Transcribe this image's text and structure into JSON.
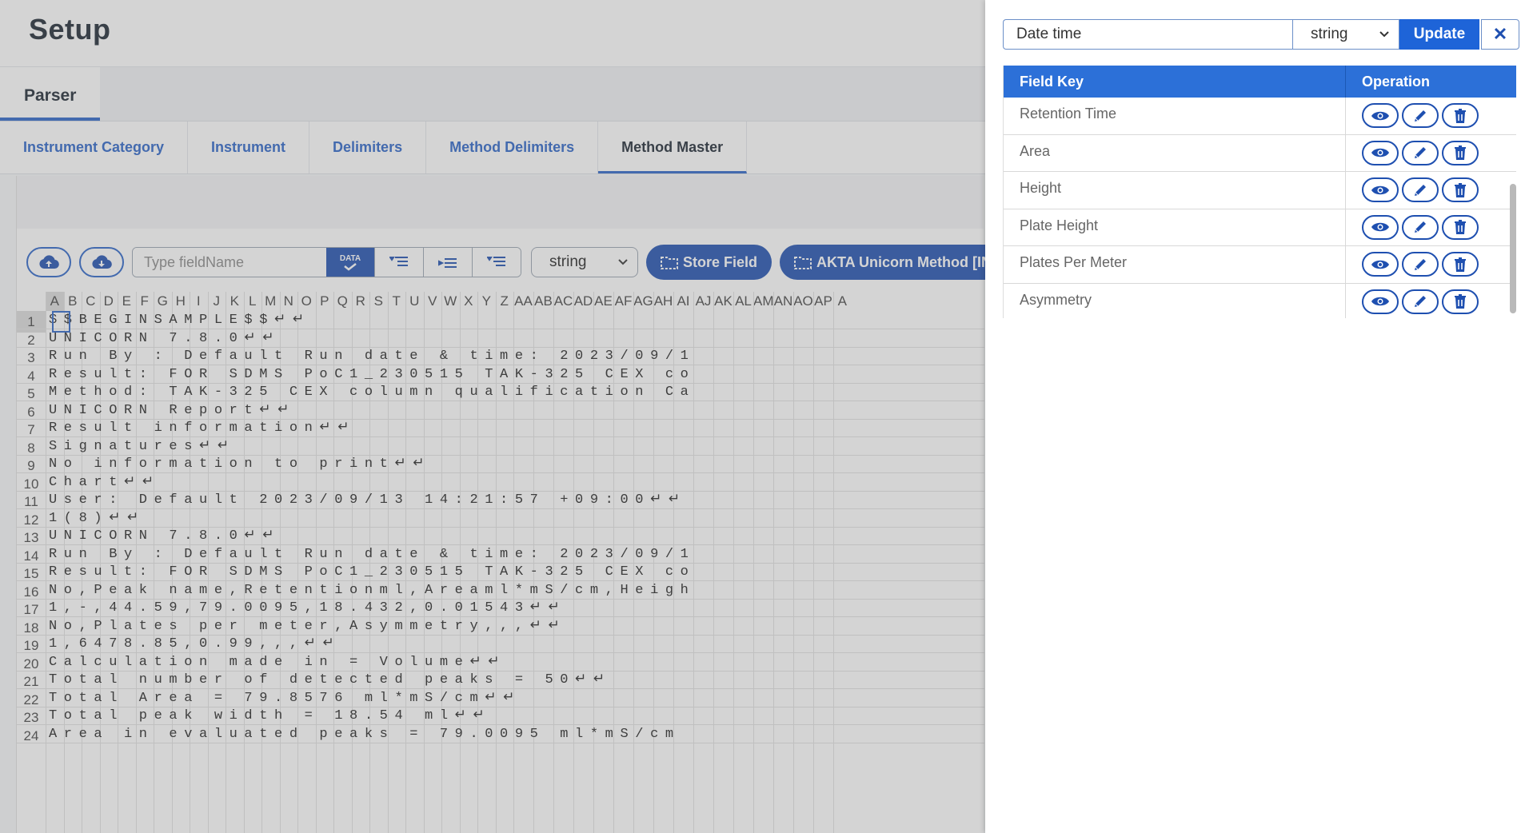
{
  "header": {
    "title": "Setup"
  },
  "primary_tabs": [
    {
      "label": "Parser"
    }
  ],
  "secondary_tabs": [
    {
      "label": "Instrument Category"
    },
    {
      "label": "Instrument"
    },
    {
      "label": "Delimiters"
    },
    {
      "label": "Method Delimiters"
    },
    {
      "label": "Method Master"
    }
  ],
  "toolbar": {
    "field_placeholder": "Type fieldName",
    "data_badge": "DATA",
    "type_select": "string",
    "store_label": "Store Field",
    "method_label": "AKTA Unicorn Method [IN"
  },
  "sheet": {
    "columns": [
      "A",
      "B",
      "C",
      "D",
      "E",
      "F",
      "G",
      "H",
      "I",
      "J",
      "K",
      "L",
      "M",
      "N",
      "O",
      "P",
      "Q",
      "R",
      "S",
      "T",
      "U",
      "V",
      "W",
      "X",
      "Y",
      "Z",
      "AA",
      "AB",
      "AC",
      "AD",
      "AE",
      "AF",
      "AG",
      "AH",
      "AI",
      "AJ",
      "AK",
      "AL",
      "AM",
      "AN",
      "AO",
      "AP",
      "A"
    ],
    "rows": [
      {
        "num": "1",
        "text": "$$BEGINSAMPLE$$↵↵"
      },
      {
        "num": "2",
        "text": "UNICORN 7.8.0↵↵"
      },
      {
        "num": "3",
        "text": "Run By : Default Run date & time: 2023/09/1"
      },
      {
        "num": "4",
        "text": "Result: FOR SDMS PoC1_230515 TAK-325 CEX co"
      },
      {
        "num": "5",
        "text": "Method: TAK-325 CEX column qualification Ca"
      },
      {
        "num": "6",
        "text": "UNICORN Report↵↵"
      },
      {
        "num": "7",
        "text": "Result information↵↵"
      },
      {
        "num": "8",
        "text": "Signatures↵↵"
      },
      {
        "num": "9",
        "text": "No information to print↵↵"
      },
      {
        "num": "10",
        "text": "Chart↵↵"
      },
      {
        "num": "11",
        "text": "User: Default 2023/09/13 14:21:57 +09:00↵↵"
      },
      {
        "num": "12",
        "text": "1(8)↵↵"
      },
      {
        "num": "13",
        "text": "UNICORN 7.8.0↵↵"
      },
      {
        "num": "14",
        "text": "Run By : Default Run date & time: 2023/09/1"
      },
      {
        "num": "15",
        "text": "Result: FOR SDMS PoC1_230515 TAK-325 CEX co"
      },
      {
        "num": "16",
        "text": "No,Peak name,Retentionml,Areaml*mS/cm,Heigh"
      },
      {
        "num": "17",
        "text": "1,-,44.59,79.0095,18.432,0.01543↵↵"
      },
      {
        "num": "18",
        "text": "No,Plates per meter,Asymmetry,,,↵↵"
      },
      {
        "num": "19",
        "text": "1,6478.85,0.99,,,↵↵"
      },
      {
        "num": "20",
        "text": "Calculation made in = Volume↵↵"
      },
      {
        "num": "21",
        "text": "Total number of detected peaks = 50↵↵"
      },
      {
        "num": "22",
        "text": "Total Area = 79.8576 ml*mS/cm↵↵"
      },
      {
        "num": "23",
        "text": "Total peak width = 18.54 ml↵↵"
      },
      {
        "num": "24",
        "text": "Area in evaluated peaks = 79.0095 ml*mS/cm"
      }
    ]
  },
  "drawer": {
    "edit_value": "Date time",
    "edit_type": "string",
    "update_label": "Update",
    "close_glyph": "✕",
    "table": {
      "col_key": "Field Key",
      "col_op": "Operation",
      "rows": [
        {
          "key": "Retention Time"
        },
        {
          "key": "Area"
        },
        {
          "key": "Height"
        },
        {
          "key": "Plate Height"
        },
        {
          "key": "Plates Per Meter"
        },
        {
          "key": "Asymmetry"
        }
      ]
    }
  },
  "colors": {
    "primary": "#1e4fb0",
    "header_blue": "#2c70d8",
    "accent": "#2a63c8"
  }
}
